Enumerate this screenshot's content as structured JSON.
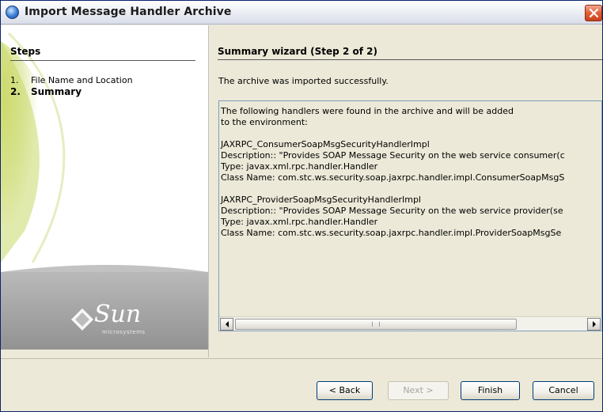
{
  "window": {
    "title": "Import Message Handler Archive"
  },
  "steps": {
    "header": "Steps",
    "items": [
      {
        "num": "1.",
        "label": "File Name and Location",
        "current": false
      },
      {
        "num": "2.",
        "label": "Summary",
        "current": true
      }
    ]
  },
  "logo": {
    "name": "Sun",
    "sub": "microsystems"
  },
  "main": {
    "title": "Summary wizard (Step 2 of 2)",
    "status": "The archive was imported successfully.",
    "text_lines": [
      "The following handlers were found in the archive and will be added",
      "to the environment:",
      "",
      "JAXRPC_ConsumerSoapMsgSecurityHandlerImpl",
      "Description:: \"Provides SOAP Message Security on the web service consumer(c",
      "Type: javax.xml.rpc.handler.Handler",
      "Class Name: com.stc.ws.security.soap.jaxrpc.handler.impl.ConsumerSoapMsgS",
      "",
      "JAXRPC_ProviderSoapMsgSecurityHandlerImpl",
      "Description:: \"Provides SOAP Message Security on the web service provider(se",
      "Type: javax.xml.rpc.handler.Handler",
      "Class Name: com.stc.ws.security.soap.jaxrpc.handler.impl.ProviderSoapMsgSe"
    ]
  },
  "buttons": {
    "back": "< Back",
    "next": "Next >",
    "finish": "Finish",
    "cancel": "Cancel"
  },
  "colors": {
    "title_accent": "#3a7bd5",
    "close_button": "#e25c35",
    "steps_art_green": "#c8d86a",
    "logo_panel_gray": "#9a9a9a"
  }
}
